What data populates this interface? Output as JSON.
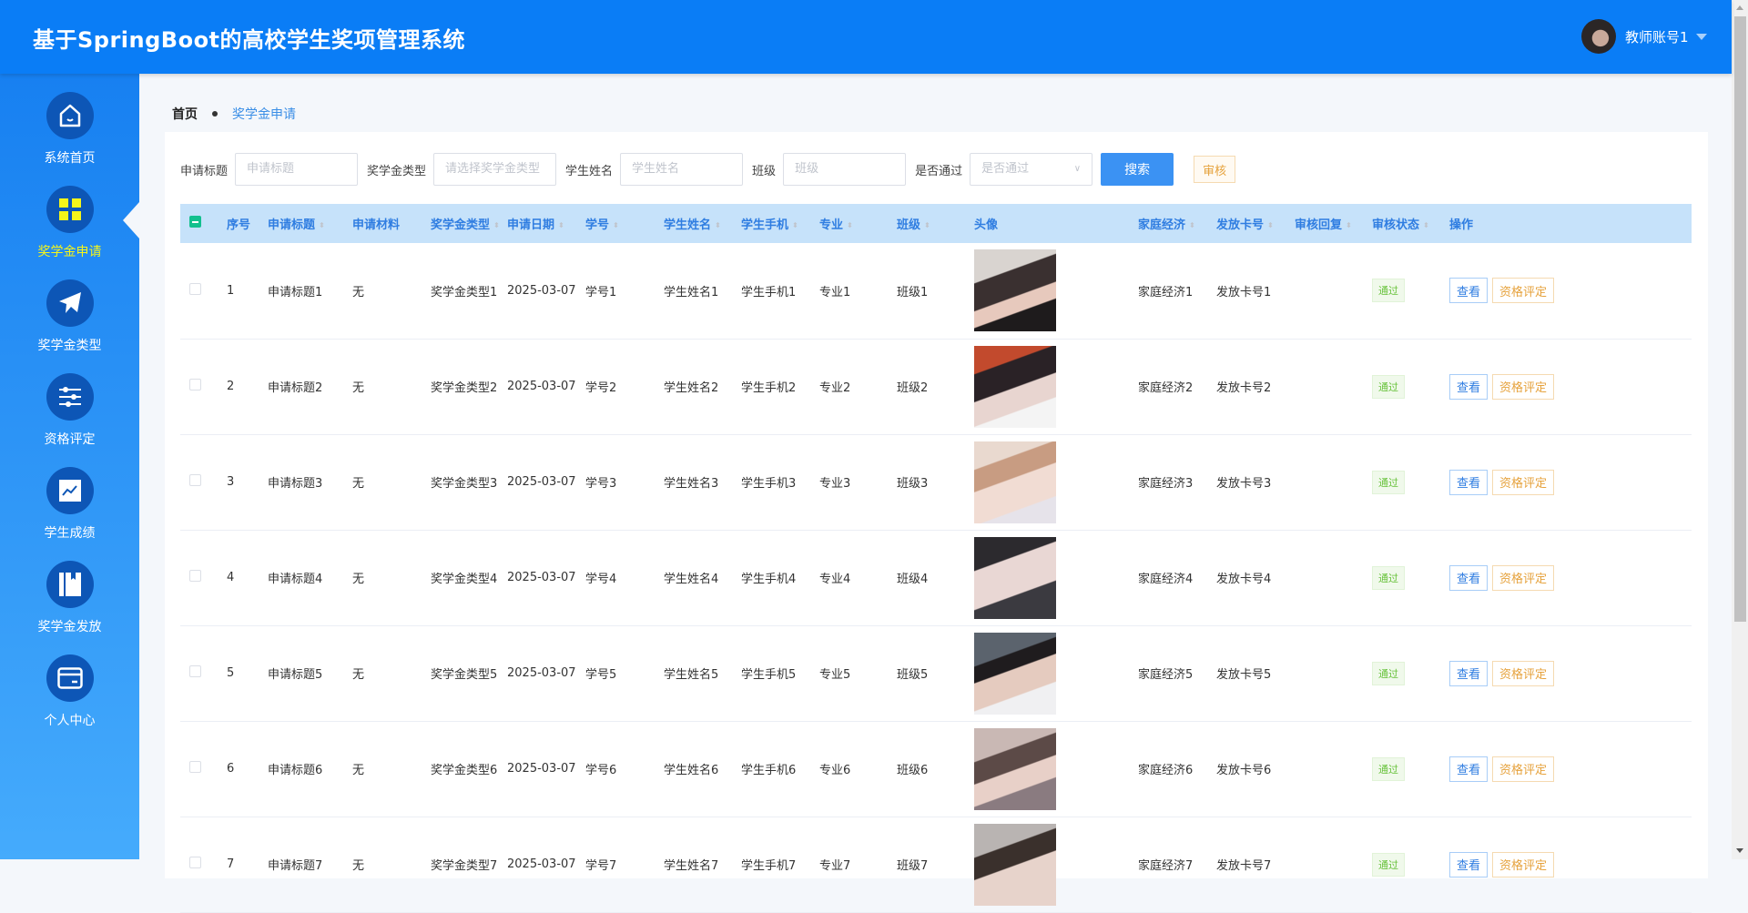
{
  "header": {
    "title": "基于SpringBoot的高校学生奖项管理系统",
    "user": "教师账号1"
  },
  "sidebar": {
    "items": [
      {
        "label": "系统首页",
        "icon": "home-icon"
      },
      {
        "label": "奖学金申请",
        "icon": "grid-icon",
        "active": true
      },
      {
        "label": "奖学金类型",
        "icon": "paper-plane-icon"
      },
      {
        "label": "资格评定",
        "icon": "sliders-icon"
      },
      {
        "label": "学生成绩",
        "icon": "chart-icon"
      },
      {
        "label": "奖学金发放",
        "icon": "book-icon"
      },
      {
        "label": "个人中心",
        "icon": "card-icon"
      }
    ]
  },
  "breadcrumb": {
    "home": "首页",
    "current": "奖学金申请"
  },
  "search": {
    "title_label": "申请标题",
    "title_placeholder": "申请标题",
    "type_label": "奖学金类型",
    "type_placeholder": "请选择奖学金类型",
    "name_label": "学生姓名",
    "name_placeholder": "学生姓名",
    "class_label": "班级",
    "class_placeholder": "班级",
    "pass_label": "是否通过",
    "pass_placeholder": "是否通过",
    "search_button": "搜索",
    "audit_button": "审核"
  },
  "table": {
    "columns": [
      "序号",
      "申请标题",
      "申请材料",
      "奖学金类型",
      "申请日期",
      "学号",
      "学生姓名",
      "学生手机",
      "专业",
      "班级",
      "头像",
      "家庭经济",
      "发放卡号",
      "审核回复",
      "审核状态",
      "操作"
    ],
    "sortable": [
      false,
      true,
      false,
      true,
      true,
      true,
      true,
      true,
      true,
      true,
      false,
      true,
      true,
      true,
      true,
      false
    ],
    "view_label": "查看",
    "eval_label": "资格评定",
    "rows": [
      {
        "no": "1",
        "title": "申请标题1",
        "material": "无",
        "type": "奖学金类型1",
        "date": "2025-03-07",
        "sid": "学号1",
        "name": "学生姓名1",
        "phone": "学生手机1",
        "major": "专业1",
        "cls": "班级1",
        "family": "家庭经济1",
        "card": "发放卡号1",
        "reply": "",
        "status": "通过"
      },
      {
        "no": "2",
        "title": "申请标题2",
        "material": "无",
        "type": "奖学金类型2",
        "date": "2025-03-07",
        "sid": "学号2",
        "name": "学生姓名2",
        "phone": "学生手机2",
        "major": "专业2",
        "cls": "班级2",
        "family": "家庭经济2",
        "card": "发放卡号2",
        "reply": "",
        "status": "通过"
      },
      {
        "no": "3",
        "title": "申请标题3",
        "material": "无",
        "type": "奖学金类型3",
        "date": "2025-03-07",
        "sid": "学号3",
        "name": "学生姓名3",
        "phone": "学生手机3",
        "major": "专业3",
        "cls": "班级3",
        "family": "家庭经济3",
        "card": "发放卡号3",
        "reply": "",
        "status": "通过"
      },
      {
        "no": "4",
        "title": "申请标题4",
        "material": "无",
        "type": "奖学金类型4",
        "date": "2025-03-07",
        "sid": "学号4",
        "name": "学生姓名4",
        "phone": "学生手机4",
        "major": "专业4",
        "cls": "班级4",
        "family": "家庭经济4",
        "card": "发放卡号4",
        "reply": "",
        "status": "通过"
      },
      {
        "no": "5",
        "title": "申请标题5",
        "material": "无",
        "type": "奖学金类型5",
        "date": "2025-03-07",
        "sid": "学号5",
        "name": "学生姓名5",
        "phone": "学生手机5",
        "major": "专业5",
        "cls": "班级5",
        "family": "家庭经济5",
        "card": "发放卡号5",
        "reply": "",
        "status": "通过"
      },
      {
        "no": "6",
        "title": "申请标题6",
        "material": "无",
        "type": "奖学金类型6",
        "date": "2025-03-07",
        "sid": "学号6",
        "name": "学生姓名6",
        "phone": "学生手机6",
        "major": "专业6",
        "cls": "班级6",
        "family": "家庭经济6",
        "card": "发放卡号6",
        "reply": "",
        "status": "通过"
      },
      {
        "no": "7",
        "title": "申请标题7",
        "material": "无",
        "type": "奖学金类型7",
        "date": "2025-03-07",
        "sid": "学号7",
        "name": "学生姓名7",
        "phone": "学生手机7",
        "major": "专业7",
        "cls": "班级7",
        "family": "家庭经济7",
        "card": "发放卡号7",
        "reply": "",
        "status": "通过"
      }
    ]
  },
  "colors": {
    "header": "#0a7df6",
    "accent": "#3b92f3",
    "active_nav": "#f5f51a",
    "success": "#67c23a",
    "warning": "#e6a23c"
  }
}
